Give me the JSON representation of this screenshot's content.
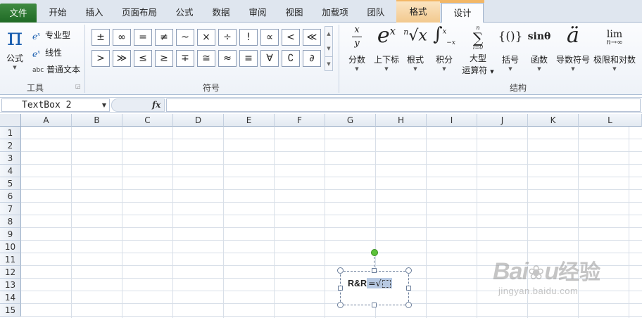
{
  "tabs": [
    {
      "label": "文件"
    },
    {
      "label": "开始"
    },
    {
      "label": "插入"
    },
    {
      "label": "页面布局"
    },
    {
      "label": "公式"
    },
    {
      "label": "数据"
    },
    {
      "label": "审阅"
    },
    {
      "label": "视图"
    },
    {
      "label": "加载项"
    },
    {
      "label": "团队"
    },
    {
      "label": "格式"
    },
    {
      "label": "设计"
    }
  ],
  "ribbon": {
    "tools": {
      "label": "工具",
      "equation": "公式",
      "pi": "π",
      "professional": "专业型",
      "linear": "线性",
      "plain_text": "普通文本",
      "abc": "abc",
      "ex": "e"
    },
    "symbols": {
      "label": "符号",
      "items": [
        "±",
        "∞",
        "=",
        "≠",
        "~",
        "×",
        "÷",
        "!",
        "∝",
        "<",
        "≪",
        ">",
        "≫",
        "≤",
        "≥",
        "∓",
        "≅",
        "≈",
        "≡",
        "∀",
        "∁",
        "∂"
      ]
    },
    "structures": {
      "label": "结构",
      "fraction": {
        "label": "分数",
        "glyph": "x/y"
      },
      "script": {
        "label": "上下标",
        "glyph": "eˣ"
      },
      "radical": {
        "label": "根式",
        "glyph": "ⁿ√x"
      },
      "integral": {
        "label": "积分",
        "glyph": "∫"
      },
      "large_operator": {
        "label": "大型\n运算符",
        "line1": "大型",
        "line2": "运算符",
        "glyph": "∑"
      },
      "bracket": {
        "label": "括号",
        "glyph": "{()}"
      },
      "function": {
        "label": "函数",
        "glyph": "sinθ"
      },
      "accent": {
        "label": "导数符号",
        "glyph": "ä"
      },
      "limit": {
        "label": "极限和对数",
        "glyph": "lim",
        "sub": "n→∞"
      }
    }
  },
  "formula_bar": {
    "name_box": "TextBox 2",
    "fx": "fx",
    "value": ""
  },
  "sheet": {
    "columns": [
      "A",
      "B",
      "C",
      "D",
      "E",
      "F",
      "G",
      "H",
      "I",
      "J",
      "K",
      "L"
    ],
    "rows": [
      "1",
      "2",
      "3",
      "4",
      "5",
      "6",
      "7",
      "8",
      "9",
      "10",
      "11",
      "12",
      "13",
      "14",
      "15"
    ]
  },
  "textbox": {
    "prefix": "R&R",
    "equation": "=√"
  },
  "watermark": {
    "logo": "Bai",
    "logo_end": "u",
    "cn": "经验",
    "url": "jingyan.baidu.com"
  },
  "colors": {
    "file_tab": "#2a7a2e",
    "context_tab": "#f3b766",
    "accent": "#1b5fb0"
  }
}
